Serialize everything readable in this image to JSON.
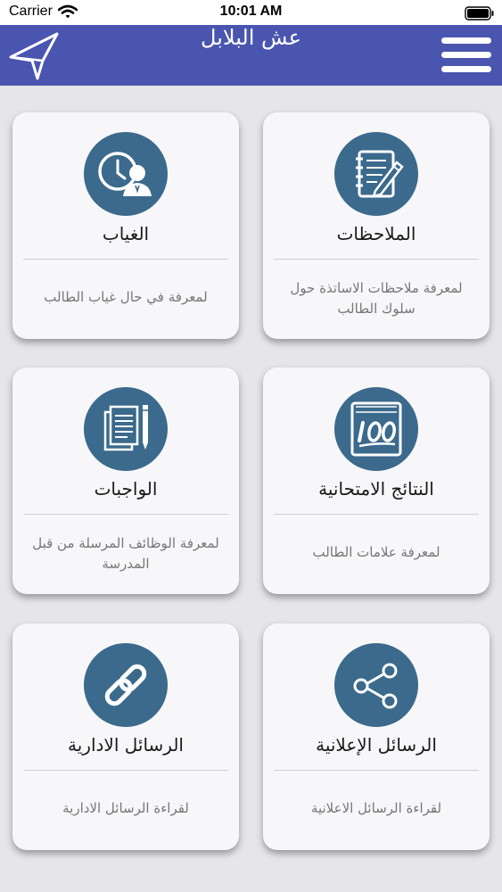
{
  "status_bar": {
    "carrier": "Carrier",
    "time": "10:01 AM"
  },
  "navbar": {
    "title": "عش البلابل"
  },
  "cards": [
    {
      "title": "الملاحظات",
      "description": "لمعرفة ملاحظات الاساتذة حول سلوك الطالب",
      "icon": "notebook-pen-icon"
    },
    {
      "title": "الغياب",
      "description": "لمعرفة في حال غياب الطالب",
      "icon": "clock-person-icon"
    },
    {
      "title": "النتائج الامتحانية",
      "description": "لمعرفة علامات الطالب",
      "icon": "score-100-icon"
    },
    {
      "title": "الواجبات",
      "description": "لمعرفة الوظائف المرسلة من قبل المدرسة",
      "icon": "documents-pen-icon"
    },
    {
      "title": "الرسائل الإعلانية",
      "description": "لقراءة الرسائل الاعلانية",
      "icon": "share-icon"
    },
    {
      "title": "الرسائل الادارية",
      "description": "لقراءة الرسائل الادارية",
      "icon": "link-icon"
    }
  ],
  "colors": {
    "navbar": "#4a55b0",
    "icon_circle": "#3b6a8c",
    "background": "#e6e6e8",
    "card": "#f7f7f9"
  }
}
